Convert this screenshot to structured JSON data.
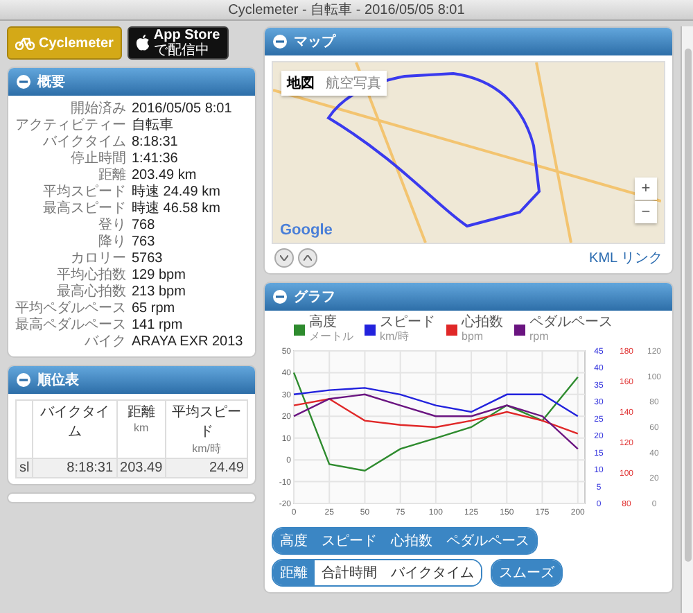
{
  "window": {
    "title": "Cyclemeter - 自転車 - 2016/05/05 8:01"
  },
  "badges": [
    {
      "kind": "cyclemeter",
      "label": "Cyclemeter"
    },
    {
      "kind": "appstore",
      "label": "App Store",
      "sublabel": "で配信中"
    }
  ],
  "summary": {
    "title": "概要",
    "rows": [
      {
        "label": "開始済み",
        "value": "2016/05/05 8:01"
      },
      {
        "label": "アクティビティー",
        "value": "自転車"
      },
      {
        "label": "バイクタイム",
        "value": "8:18:31"
      },
      {
        "label": "停止時間",
        "value": "1:41:36"
      },
      {
        "label": "距離",
        "value": "203.49 km"
      },
      {
        "label": "平均スピード",
        "value": "時速 24.49 km"
      },
      {
        "label": "最高スピード",
        "value": "時速 46.58 km"
      },
      {
        "label": "登り",
        "value": "768"
      },
      {
        "label": "降り",
        "value": "763"
      },
      {
        "label": "カロリー",
        "value": "5763"
      },
      {
        "label": "平均心拍数",
        "value": "129 bpm"
      },
      {
        "label": "最高心拍数",
        "value": "213 bpm"
      },
      {
        "label": "平均ペダルペース",
        "value": "65 rpm"
      },
      {
        "label": "最高ペダルペース",
        "value": "141 rpm"
      },
      {
        "label": "バイク",
        "value": "ARAYA EXR 2013"
      }
    ]
  },
  "ranking": {
    "title": "順位表",
    "columns": [
      {
        "label": "バイクタイム"
      },
      {
        "label": "距離",
        "unit": "km"
      },
      {
        "label": "平均スピード",
        "unit": "km/時"
      }
    ],
    "rows": [
      {
        "label": "sl",
        "values": [
          "8:18:31",
          "203.49",
          "24.49"
        ]
      }
    ]
  },
  "map": {
    "title": "マップ",
    "map_types": [
      {
        "label": "地図",
        "selected": true
      },
      {
        "label": "航空写真",
        "selected": false
      }
    ],
    "logo": "Google",
    "zoom_in": "+",
    "zoom_out": "−",
    "link": "KML リンク"
  },
  "graph": {
    "title": "グラフ",
    "chart_data": {
      "type": "line",
      "x": [
        0,
        25,
        50,
        75,
        100,
        125,
        150,
        175,
        200
      ],
      "xticks": [
        0,
        25,
        50,
        75,
        100,
        125,
        150,
        175,
        200
      ],
      "xlim": [
        0,
        205
      ],
      "ylim": [
        -20,
        50
      ],
      "yticks": [
        -20,
        -10,
        0,
        10,
        20,
        30,
        40,
        50
      ],
      "grid": true,
      "series": [
        {
          "name": "高度",
          "color": "#2e8b2e",
          "values": [
            40,
            -2,
            -5,
            5,
            10,
            15,
            25,
            18,
            38
          ]
        },
        {
          "name": "スピード",
          "color": "#2222dd",
          "values": [
            30,
            32,
            33,
            30,
            25,
            22,
            30,
            30,
            20
          ]
        },
        {
          "name": "心拍数",
          "color": "#e02828",
          "values": [
            25,
            28,
            18,
            16,
            15,
            18,
            22,
            18,
            12
          ]
        },
        {
          "name": "ペダルペース",
          "color": "#6a1480",
          "values": [
            20,
            28,
            30,
            25,
            20,
            20,
            25,
            20,
            5
          ]
        }
      ]
    },
    "right_axes": [
      {
        "color": "#3333dd",
        "ticks": [
          "45",
          "40",
          "35",
          "30",
          "25",
          "20",
          "15",
          "10",
          "5",
          "0"
        ]
      },
      {
        "color": "#e03030",
        "ticks": [
          "180",
          "160",
          "140",
          "120",
          "100",
          "80"
        ]
      },
      {
        "color": "#888888",
        "ticks": [
          "120",
          "100",
          "80",
          "60",
          "40",
          "20",
          "0"
        ]
      }
    ],
    "legend_units": [
      "メートル",
      "km/時",
      "bpm",
      "rpm"
    ],
    "button_groups": [
      [
        {
          "label": "高度",
          "selected": true
        },
        {
          "label": "スピード",
          "selected": true
        },
        {
          "label": "心拍数",
          "selected": true
        },
        {
          "label": "ペダルペース",
          "selected": true
        }
      ],
      [
        {
          "label": "距離",
          "selected": true
        },
        {
          "label": "合計時間",
          "selected": false
        },
        {
          "label": "バイクタイム",
          "selected": false
        }
      ],
      [
        {
          "label": "スムーズ",
          "selected": true
        }
      ]
    ]
  }
}
